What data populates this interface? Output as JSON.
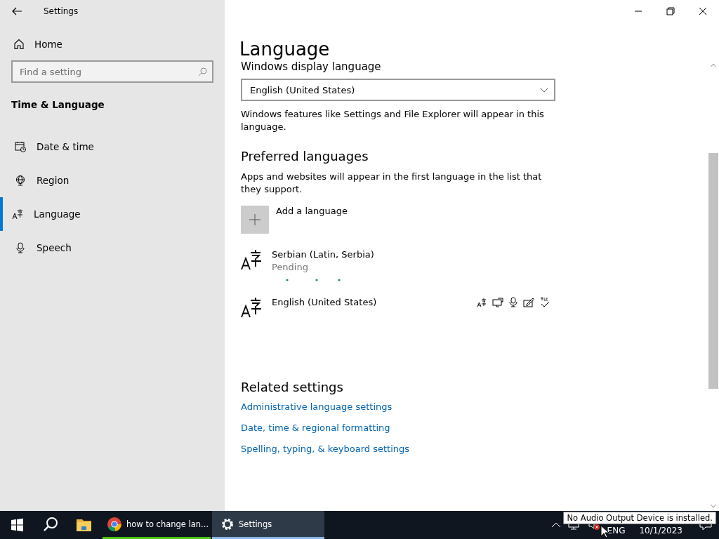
{
  "window": {
    "title": "Settings"
  },
  "sidebar": {
    "home": "Home",
    "search": {
      "placeholder": "Find a setting"
    },
    "category": "Time & Language",
    "items": [
      {
        "label": "Date & time",
        "kind": "calendar",
        "selected": false
      },
      {
        "label": "Region",
        "kind": "globe",
        "selected": false
      },
      {
        "label": "Language",
        "kind": "language",
        "selected": true
      },
      {
        "label": "Speech",
        "kind": "microphone",
        "selected": false
      }
    ]
  },
  "page": {
    "title": "Language",
    "display_language": {
      "heading": "Windows display language",
      "value": "English (United States)",
      "description": "Windows features like Settings and File Explorer will appear in this language."
    },
    "preferred": {
      "heading": "Preferred languages",
      "description": "Apps and websites will appear in the first language in the list that they support.",
      "add_label": "Add a language",
      "languages": [
        {
          "name": "Serbian (Latin, Serbia)",
          "status": "Pending",
          "installing": true,
          "features": false
        },
        {
          "name": "English (United States)",
          "installing": false,
          "features": true
        }
      ]
    },
    "related": {
      "heading": "Related settings",
      "links": [
        "Administrative language settings",
        "Date, time & regional formatting",
        "Spelling, typing, & keyboard settings"
      ]
    }
  },
  "taskbar": {
    "apps": [
      {
        "kind": "chrome",
        "label": "how to change lan...",
        "selected": false
      },
      {
        "kind": "settings",
        "label": "Settings",
        "selected": true
      }
    ],
    "language": "ENG",
    "date": "10/1/2023"
  },
  "tooltip": "No Audio Output Device is installed."
}
